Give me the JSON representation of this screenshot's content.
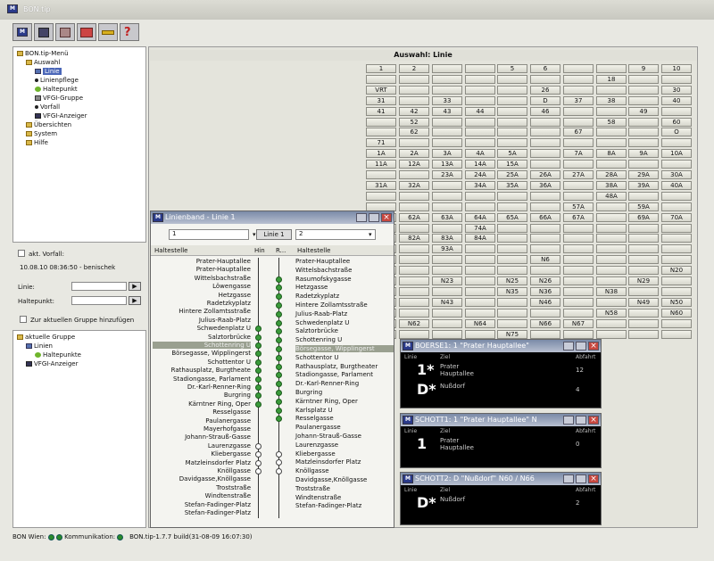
{
  "app": {
    "title": "BON.tip"
  },
  "toolbar": {
    "icons": [
      "logo-icon",
      "chart-icon",
      "list-icon",
      "money-icon",
      "key-icon",
      "help-icon"
    ]
  },
  "menu_tree": [
    {
      "label": "BON.tip-Menü",
      "indent": 0,
      "icon": "folder"
    },
    {
      "label": "Auswahl",
      "indent": 1,
      "icon": "folder"
    },
    {
      "label": "Linie",
      "indent": 2,
      "icon": "line",
      "selected": true
    },
    {
      "label": "Linienpflege",
      "indent": 2,
      "icon": "dot"
    },
    {
      "label": "Haltepunkt",
      "indent": 2,
      "icon": "greendot"
    },
    {
      "label": "VFGI-Gruppe",
      "indent": 2,
      "icon": "group"
    },
    {
      "label": "Vorfall",
      "indent": 2,
      "icon": "dot"
    },
    {
      "label": "VFGI-Anzeiger",
      "indent": 2,
      "icon": "display"
    },
    {
      "label": "Übersichten",
      "indent": 1,
      "icon": "folder"
    },
    {
      "label": "System",
      "indent": 1,
      "icon": "folder"
    },
    {
      "label": "Hilfe",
      "indent": 1,
      "icon": "folder"
    }
  ],
  "incident": {
    "checkbox_label": "akt. Vorfall:",
    "timestamp": "10.08.10 08:36:50 - benischek",
    "line_label": "Linie:",
    "stop_label": "Haltepunkt:",
    "go": "▶",
    "group_checkbox": "Zur aktuellen Gruppe hinzufügen"
  },
  "group_tree": [
    {
      "label": "aktuelle Gruppe",
      "indent": 0,
      "icon": "folder"
    },
    {
      "label": "Linien",
      "indent": 1,
      "icon": "line"
    },
    {
      "label": "Haltepunkte",
      "indent": 2,
      "icon": "greendot"
    },
    {
      "label": "VFGI-Anzeiger",
      "indent": 1,
      "icon": "display"
    }
  ],
  "grid": {
    "title": "Auswahl: Linie",
    "rows": [
      [
        "1",
        "2",
        "",
        "",
        "5",
        "6",
        "",
        "",
        "9",
        "10"
      ],
      [
        "",
        "",
        "",
        "",
        "",
        "",
        "",
        "18",
        "",
        ""
      ],
      [
        "VRT",
        "",
        "",
        "",
        "",
        "26",
        "",
        "",
        "",
        "30"
      ],
      [
        "31",
        "",
        "33",
        "",
        "",
        "D",
        "37",
        "38",
        "",
        "40"
      ],
      [
        "41",
        "42",
        "43",
        "44",
        "",
        "46",
        "",
        "",
        "49",
        ""
      ],
      [
        "",
        "52",
        "",
        "",
        "",
        "",
        "",
        "58",
        "",
        "60"
      ],
      [
        "",
        "62",
        "",
        "",
        "",
        "",
        "67",
        "",
        "",
        "O"
      ],
      [
        "71",
        "",
        "",
        "",
        "",
        "",
        "",
        "",
        "",
        ""
      ],
      [
        "1A",
        "2A",
        "3A",
        "4A",
        "5A",
        "",
        "7A",
        "8A",
        "9A",
        "10A"
      ],
      [
        "11A",
        "12A",
        "13A",
        "14A",
        "15A",
        "",
        "",
        "",
        "",
        ""
      ],
      [
        "",
        "",
        "23A",
        "24A",
        "25A",
        "26A",
        "27A",
        "28A",
        "29A",
        "30A"
      ],
      [
        "31A",
        "32A",
        "",
        "34A",
        "35A",
        "36A",
        "",
        "38A",
        "39A",
        "40A"
      ],
      [
        "",
        "",
        "",
        "",
        "",
        "",
        "",
        "48A",
        "",
        ""
      ],
      [
        "",
        "",
        "",
        "",
        "",
        "",
        "57A",
        "",
        "59A",
        ""
      ],
      [
        "",
        "62A",
        "63A",
        "64A",
        "65A",
        "66A",
        "67A",
        "",
        "69A",
        "70A"
      ],
      [
        "",
        "",
        "",
        "74A",
        "",
        "",
        "",
        "",
        "",
        ""
      ],
      [
        "",
        "82A",
        "83A",
        "84A",
        "",
        "",
        "",
        "",
        "",
        ""
      ],
      [
        "",
        "",
        "93A",
        "",
        "",
        "",
        "",
        "",
        "",
        ""
      ],
      [
        "",
        "",
        "",
        "",
        "",
        "N6",
        "",
        "",
        "",
        ""
      ],
      [
        "",
        "",
        "",
        "",
        "",
        "",
        "",
        "",
        "",
        "N20"
      ],
      [
        "",
        "",
        "N23",
        "",
        "N25",
        "N26",
        "",
        "",
        "N29",
        ""
      ],
      [
        "",
        "",
        "",
        "",
        "N35",
        "N36",
        "",
        "N38",
        "",
        ""
      ],
      [
        "",
        "",
        "N43",
        "",
        "",
        "N46",
        "",
        "",
        "N49",
        "N50"
      ],
      [
        "",
        "",
        "",
        "",
        "",
        "",
        "",
        "N58",
        "",
        "N60"
      ],
      [
        "",
        "N62",
        "",
        "N64",
        "",
        "N66",
        "N67",
        "",
        "",
        ""
      ],
      [
        "",
        "",
        "",
        "",
        "N75",
        "",
        "",
        "",
        "",
        ""
      ]
    ]
  },
  "linienband": {
    "title": "Linienband - Linie 1",
    "select_left": "1",
    "button": "Linie 1",
    "select_right": "2",
    "col_stop_left": "Haltestelle",
    "col_hin": "Hin",
    "col_rueck": "R...",
    "col_stop_right": "Haltestelle",
    "stops_left": [
      "Prater-Hauptallee",
      "Prater-Hauptallee",
      "Wittelsbachstraße",
      "Löwengasse",
      "Hetzgasse",
      "Radetzkyplatz",
      "Hintere Zollamtsstraße",
      "Julius-Raab-Platz",
      "Schwedenplatz U",
      "Salztorbrücke",
      "Schottenring U",
      "Börsegasse, Wipplingerst",
      "Schottentor U",
      "Rathausplatz, Burgtheate",
      "Stadiongasse, Parlament",
      "Dr.-Karl-Renner-Ring",
      "Burgring",
      "Kärntner Ring, Oper",
      "Resselgasse",
      "Paulanergasse",
      "Mayerhofgasse",
      "Johann-Strauß-Gasse",
      "Laurenzgasse",
      "Kliebergasse",
      "Matzleinsdorfer Platz",
      "Knöllgasse",
      "Davidgasse,Knöllgasse",
      "Troststraße",
      "Windtenstraße",
      "Stefan-Fadinger-Platz",
      "Stefan-Fadinger-Platz"
    ],
    "stops_right": [
      "Prater-Hauptallee",
      "Wittelsbachstraße",
      "Rasumofskygasse",
      "Hetzgasse",
      "Radetzkyplatz",
      "Hintere Zollamtsstraße",
      "Julius-Raab-Platz",
      "Schwedenplatz U",
      "Salztorbrücke",
      "Schottenring U",
      "Börsegasse, Wipplingerst",
      "Schottentor U",
      "Rathausplatz, Burgtheater",
      "Stadiongasse, Parlament",
      "Dr.-Karl-Renner-Ring",
      "Burgring",
      "Kärntner Ring, Oper",
      "Karlsplatz U",
      "Resselgasse",
      "Paulanergasse",
      "Johann-Strauß-Gasse",
      "Laurenzgasse",
      "Kliebergasse",
      "Matzleinsdorfer Platz",
      "Knöllgasse",
      "Davidgasse,Knöllgasse",
      "Troststraße",
      "Windtenstraße",
      "Stefan-Fadinger-Platz"
    ]
  },
  "displays": [
    {
      "title": "BOERSE1: 1 \"Prater Hauptallee\"",
      "col_line": "Linie",
      "col_dest": "Ziel",
      "col_dep": "Abfahrt",
      "rows": [
        {
          "line": "1*",
          "dest": "Prater Hauptallee",
          "dep": "12"
        },
        {
          "line": "D*",
          "dest": "Nußdorf",
          "dep": "4"
        }
      ]
    },
    {
      "title": "SCHOTT1: 1 \"Prater Hauptallee\" N",
      "col_line": "Linie",
      "col_dest": "Ziel",
      "col_dep": "Abfahrt",
      "rows": [
        {
          "line": "1",
          "dest": "Prater Hauptallee",
          "dep": "0"
        }
      ]
    },
    {
      "title": "SCHOTT2: D \"Nußdorf\" N60 / N66",
      "col_line": "Linie",
      "col_dest": "Ziel",
      "col_dep": "Abfahrt",
      "rows": [
        {
          "line": "D*",
          "dest": "Nußdorf",
          "dep": "2"
        }
      ]
    }
  ],
  "status": {
    "bon_label": "BON Wien:",
    "comm_label": "Kommunikation:",
    "version": "BON.tip-1.7.7 build(31-08-09 16:07:30)"
  }
}
